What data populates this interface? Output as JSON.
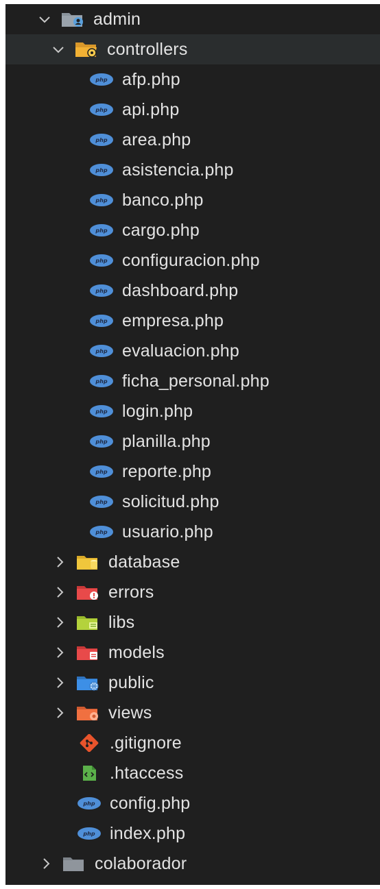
{
  "tree": {
    "admin": {
      "label": "admin",
      "expanded": true,
      "icon": "folder-admin-icon"
    },
    "controllers": {
      "label": "controllers",
      "expanded": true,
      "icon": "folder-controllers-icon",
      "files": [
        {
          "label": "afp.php",
          "icon": "php-icon"
        },
        {
          "label": "api.php",
          "icon": "php-icon"
        },
        {
          "label": "area.php",
          "icon": "php-icon"
        },
        {
          "label": "asistencia.php",
          "icon": "php-icon"
        },
        {
          "label": "banco.php",
          "icon": "php-icon"
        },
        {
          "label": "cargo.php",
          "icon": "php-icon"
        },
        {
          "label": "configuracion.php",
          "icon": "php-icon"
        },
        {
          "label": "dashboard.php",
          "icon": "php-icon"
        },
        {
          "label": "empresa.php",
          "icon": "php-icon"
        },
        {
          "label": "evaluacion.php",
          "icon": "php-icon"
        },
        {
          "label": "ficha_personal.php",
          "icon": "php-icon"
        },
        {
          "label": "login.php",
          "icon": "php-icon"
        },
        {
          "label": "planilla.php",
          "icon": "php-icon"
        },
        {
          "label": "reporte.php",
          "icon": "php-icon"
        },
        {
          "label": "solicitud.php",
          "icon": "php-icon"
        },
        {
          "label": "usuario.php",
          "icon": "php-icon"
        }
      ]
    },
    "folders": [
      {
        "label": "database",
        "icon": "folder-database-icon",
        "color": "#f0c63c",
        "badge": "#e8b830"
      },
      {
        "label": "errors",
        "icon": "folder-errors-icon",
        "color": "#e84a4a",
        "badge": "#ffffff"
      },
      {
        "label": "libs",
        "icon": "folder-libs-icon",
        "color": "#b4d23c",
        "badge": "#7fae2a"
      },
      {
        "label": "models",
        "icon": "folder-models-icon",
        "color": "#e84a4a",
        "badge": "#ffffff"
      },
      {
        "label": "public",
        "icon": "folder-public-icon",
        "color": "#3d8fe6",
        "badge": "#6fb6ff"
      },
      {
        "label": "views",
        "icon": "folder-views-icon",
        "color": "#f07040",
        "badge": "#ff9a70"
      }
    ],
    "root_files": [
      {
        "label": ".gitignore",
        "icon": "git-icon"
      },
      {
        "label": ".htaccess",
        "icon": "htaccess-icon"
      },
      {
        "label": "config.php",
        "icon": "php-icon"
      },
      {
        "label": "index.php",
        "icon": "php-icon"
      }
    ],
    "colaborador": {
      "label": "colaborador",
      "expanded": false,
      "icon": "folder-icon"
    }
  },
  "colors": {
    "background": "#1f1f1f",
    "selected_row": "#2a2d2e",
    "text": "#e3e3e3",
    "php_blue": "#4f8fd8",
    "folder_orange": "#f2b134",
    "folder_grey": "#8f959c"
  }
}
